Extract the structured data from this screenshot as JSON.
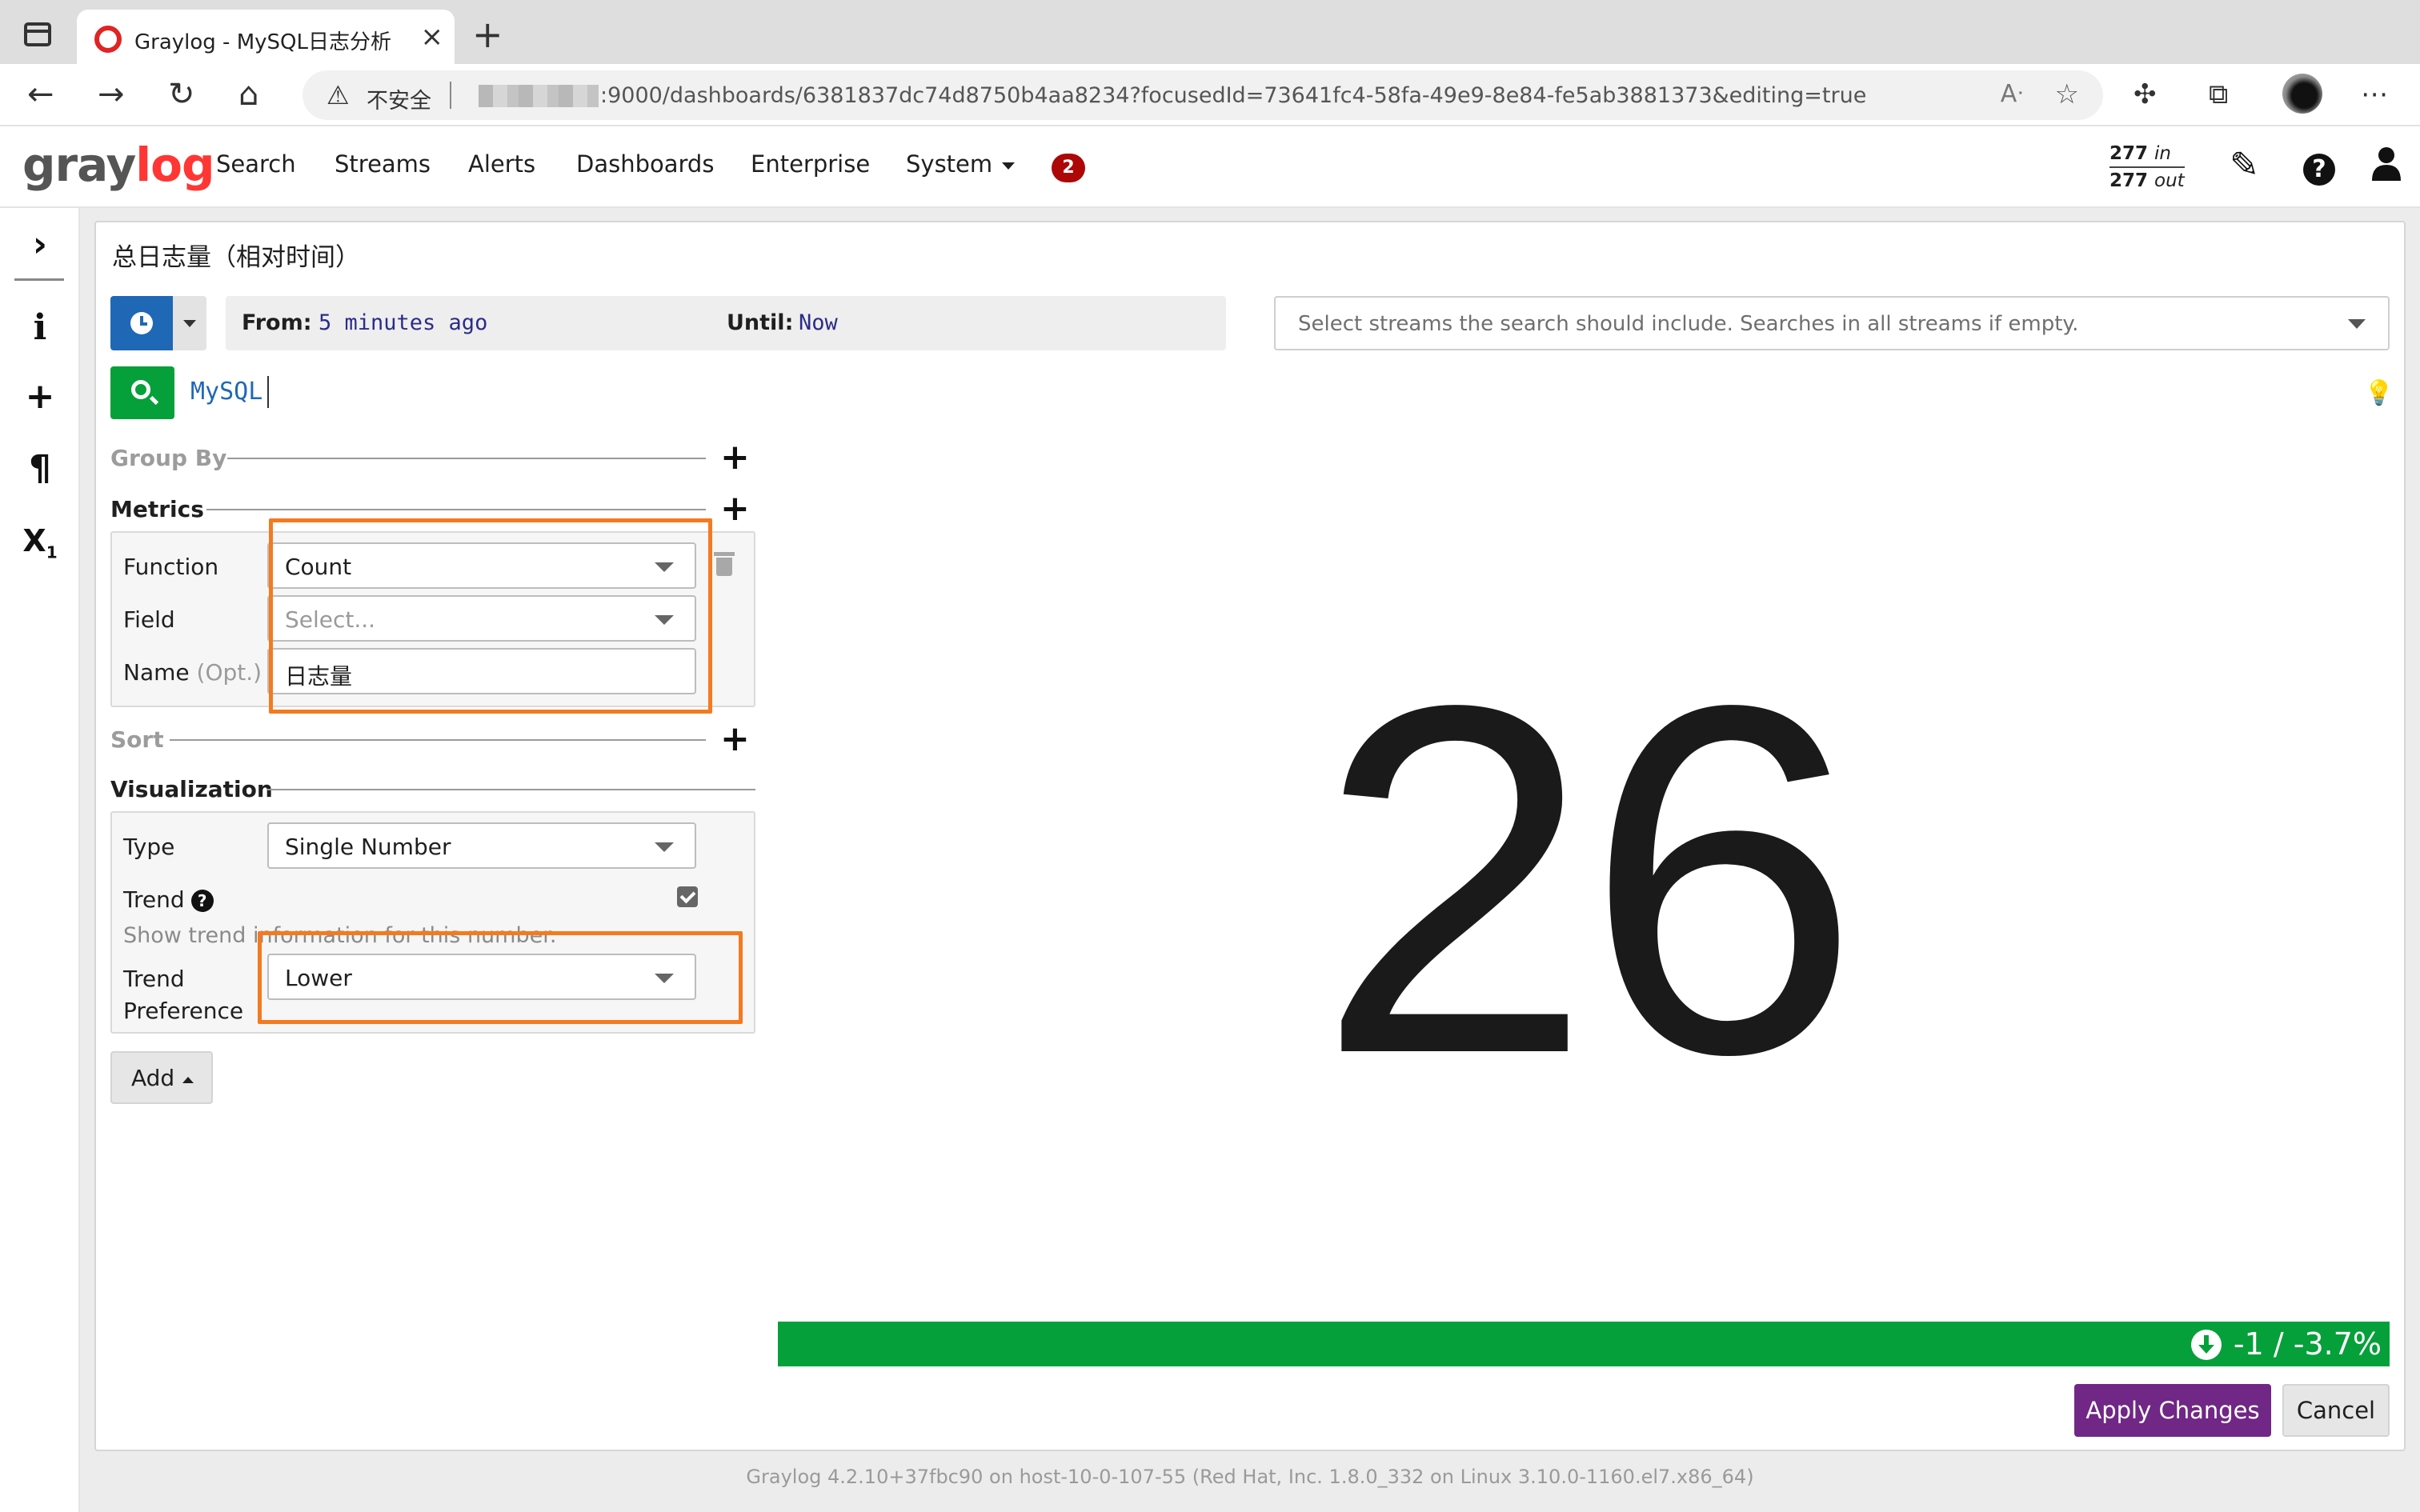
{
  "browser": {
    "tab_title": "Graylog - MySQL日志分析",
    "new_tab": "+",
    "insecure_label": "不安全",
    "url": ":9000/dashboards/6381837dc74d8750b4aa8234?focusedId=73641fc4-58fa-49e9-8e84-fe5ab3881373&editing=true"
  },
  "nav": {
    "logo_a": "gray",
    "logo_b": "log",
    "items": [
      "Search",
      "Streams",
      "Alerts",
      "Dashboards",
      "Enterprise",
      "System"
    ],
    "notifications": "2",
    "throughput_in": "277",
    "throughput_in_label": "in",
    "throughput_out": "277",
    "throughput_out_label": "out"
  },
  "widget": {
    "title": "总日志量（相对时间）",
    "from_label": "From:",
    "from_value": "5 minutes ago",
    "until_label": "Until:",
    "until_value": "Now",
    "streams_placeholder": "Select streams the search should include. Searches in all streams if empty.",
    "query": "MySQL"
  },
  "editor": {
    "group_by": "Group By",
    "metrics": "Metrics",
    "function_label": "Function",
    "function_value": "Count",
    "field_label": "Field",
    "field_placeholder": "Select...",
    "name_label": "Name",
    "name_opt": "(Opt.)",
    "name_value": "日志量",
    "sort": "Sort",
    "visualization": "Visualization",
    "type_label": "Type",
    "type_value": "Single Number",
    "trend_label": "Trend",
    "trend_help": "Show trend information for this number.",
    "trend_pref_label_1": "Trend",
    "trend_pref_label_2": "Preference",
    "trend_pref_value": "Lower",
    "add_label": "Add"
  },
  "result": {
    "value": "26",
    "trend_text": "-1 / -3.7%",
    "trend_color": "#06a03a"
  },
  "actions": {
    "apply": "Apply Changes",
    "cancel": "Cancel"
  },
  "footer": "Graylog 4.2.10+37fbc90 on host-10-0-107-55 (Red Hat, Inc. 1.8.0_332 on Linux 3.10.0-1160.el7.x86_64)",
  "colors": {
    "accent": "#1f68b5",
    "primary_action": "#702785",
    "search_green": "#06a03a",
    "annotation_orange": "#f47a20",
    "brand_red": "#ff3633"
  }
}
